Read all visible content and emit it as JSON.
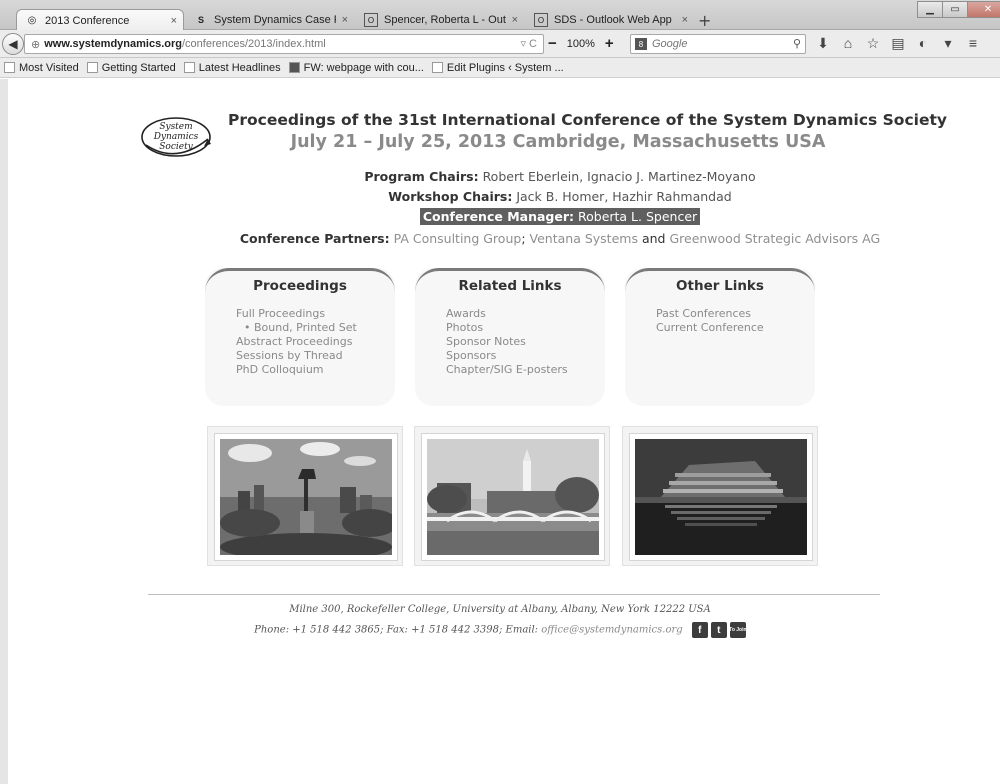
{
  "browser": {
    "tabs": [
      {
        "label": "2013 Conference",
        "icon": "ring-icon",
        "active": true
      },
      {
        "label": "System Dynamics Case Re...",
        "icon": "sd-icon",
        "active": false
      },
      {
        "label": "Spencer, Roberta L - Outlo...",
        "icon": "outlook-icon",
        "active": false
      },
      {
        "label": "SDS - Outlook Web App",
        "icon": "outlook-icon",
        "active": false
      }
    ],
    "new_tab_symbol": "+",
    "url_domain": "www.systemdynamics.org",
    "url_path": "/conferences/2013/index.html",
    "zoom": "100%",
    "search_placeholder": "Google",
    "bookmarks": [
      "Most Visited",
      "Getting Started",
      "Latest Headlines",
      "FW: webpage with cou...",
      "Edit Plugins ‹ System ..."
    ]
  },
  "header": {
    "logo_text": [
      "System",
      "Dynamics",
      "Society"
    ],
    "title": "Proceedings of the 31st International Conference of the System Dynamics Society",
    "dates": "July 21 – July 25, 2013 Cambridge, Massachusetts USA"
  },
  "credits": {
    "program_label": "Program Chairs:",
    "program_names": "Robert Eberlein, Ignacio J. Martinez-Moyano",
    "workshop_label": "Workshop Chairs:",
    "workshop_names": "Jack B. Homer, Hazhir Rahmandad",
    "manager_label": "Conference Manager:",
    "manager_name": "Roberta L. Spencer",
    "partners_label": "Conference Partners:",
    "partner1": "PA Consulting Group",
    "sep1": ";",
    "partner2": "Ventana Systems",
    "and": "and",
    "partner3": "Greenwood Strategic Advisors AG"
  },
  "boxes": {
    "proceedings": {
      "title": "Proceedings",
      "items": [
        "Full Proceedings",
        "• Bound, Printed Set",
        "Abstract Proceedings",
        "Sessions by Thread",
        "PhD Colloquium"
      ]
    },
    "related": {
      "title": "Related Links",
      "items": [
        "Awards",
        "Photos",
        "Sponsor Notes",
        "Sponsors",
        "Chapter/SIG E-posters"
      ]
    },
    "other": {
      "title": "Other Links",
      "items": [
        "Past Conferences",
        "Current Conference"
      ]
    }
  },
  "footer": {
    "address": "Milne 300, Rockefeller College, University at Albany, Albany, New York 12222 USA",
    "contact": "Phone: +1 518 442 3865; Fax: +1 518 442 3398; Email:",
    "email": "office@systemdynamics.org",
    "social": [
      "f",
      "t",
      "To Join"
    ]
  }
}
